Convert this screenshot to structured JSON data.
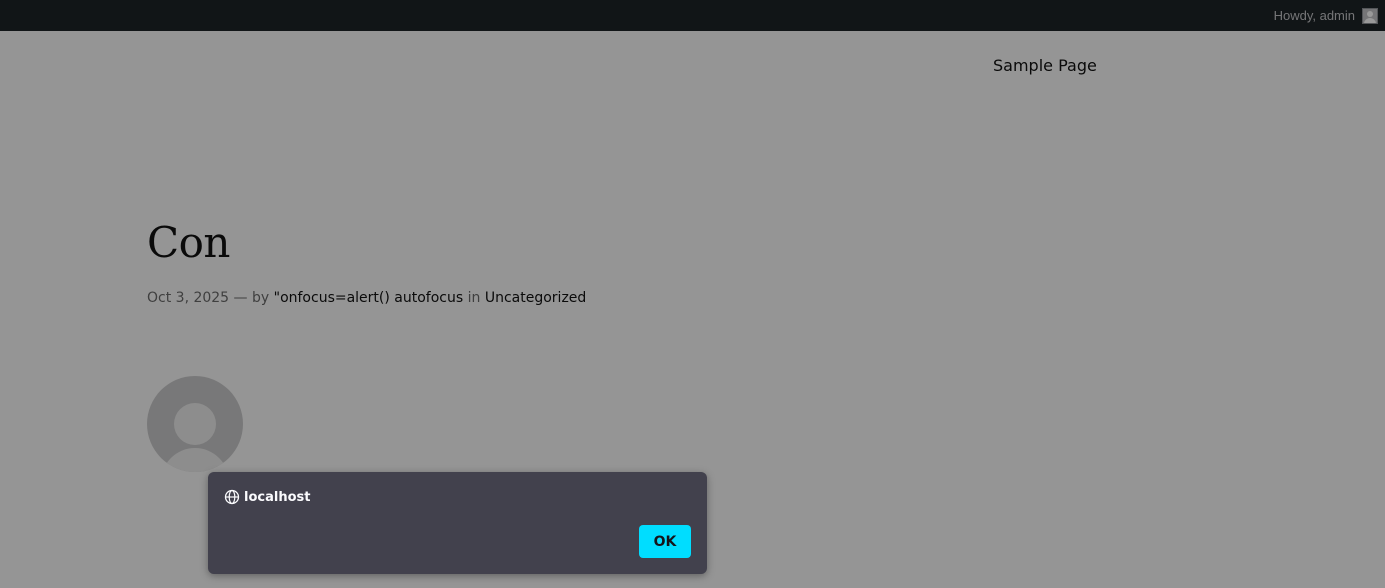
{
  "admin_bar": {
    "greeting": "Howdy, admin"
  },
  "nav": {
    "items": [
      {
        "label": "Sample Page"
      }
    ]
  },
  "post": {
    "title": "Con",
    "date": "Oct 3, 2025",
    "separator": "—",
    "by_label": "by",
    "author": "\"onfocus=alert() autofocus",
    "in_label": "in",
    "category": "Uncategorized"
  },
  "dialog": {
    "origin": "localhost",
    "ok_label": "OK",
    "icon": "globe-icon"
  },
  "colors": {
    "admin_bar_bg": "#1d2327",
    "dialog_bg": "#42414d",
    "ok_button": "#00ddff"
  }
}
